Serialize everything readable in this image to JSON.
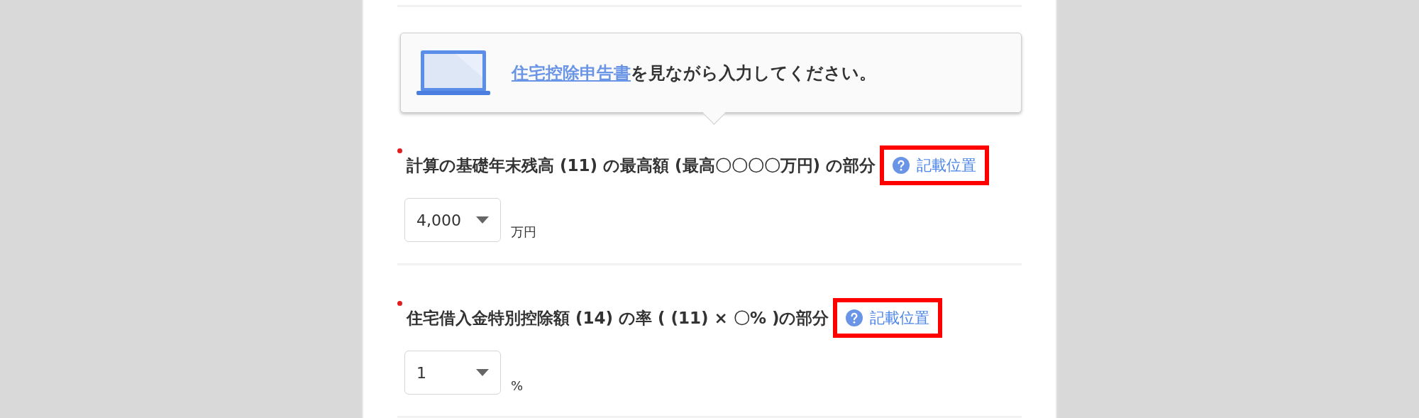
{
  "notice": {
    "link": "住宅控除申告書",
    "text": "を見ながら入力してください。"
  },
  "fields": [
    {
      "label": "計算の基礎年末残高 (11) の最高額 (最高〇〇〇〇万円) の部分",
      "required": true,
      "help": {
        "label": "記載位置",
        "highlighted": true
      },
      "value": "4,000",
      "unit": "万円"
    },
    {
      "label": "住宅借入金特別控除額 (14) の率 ( (11) × 〇% )の部分",
      "required": true,
      "help": {
        "label": "記載位置",
        "highlighted": true
      },
      "value": "1",
      "unit": "%"
    }
  ]
}
